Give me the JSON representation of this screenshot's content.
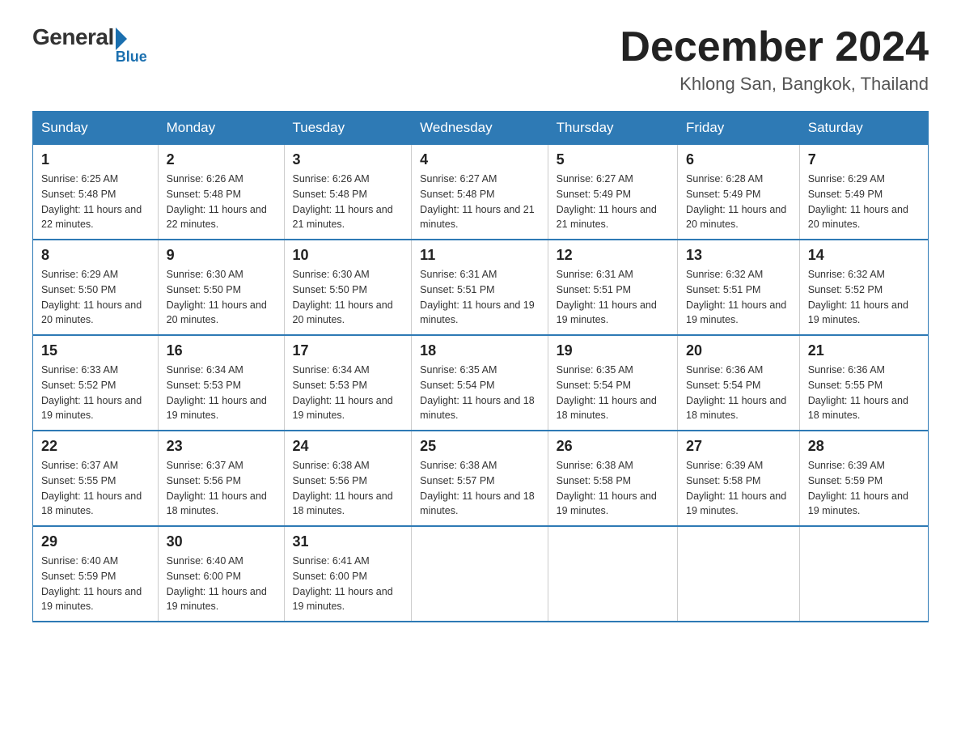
{
  "logo": {
    "general": "General",
    "blue": "Blue"
  },
  "title": "December 2024",
  "subtitle": "Khlong San, Bangkok, Thailand",
  "weekdays": [
    "Sunday",
    "Monday",
    "Tuesday",
    "Wednesday",
    "Thursday",
    "Friday",
    "Saturday"
  ],
  "weeks": [
    [
      {
        "day": "1",
        "sunrise": "6:25 AM",
        "sunset": "5:48 PM",
        "daylight": "11 hours and 22 minutes."
      },
      {
        "day": "2",
        "sunrise": "6:26 AM",
        "sunset": "5:48 PM",
        "daylight": "11 hours and 22 minutes."
      },
      {
        "day": "3",
        "sunrise": "6:26 AM",
        "sunset": "5:48 PM",
        "daylight": "11 hours and 21 minutes."
      },
      {
        "day": "4",
        "sunrise": "6:27 AM",
        "sunset": "5:48 PM",
        "daylight": "11 hours and 21 minutes."
      },
      {
        "day": "5",
        "sunrise": "6:27 AM",
        "sunset": "5:49 PM",
        "daylight": "11 hours and 21 minutes."
      },
      {
        "day": "6",
        "sunrise": "6:28 AM",
        "sunset": "5:49 PM",
        "daylight": "11 hours and 20 minutes."
      },
      {
        "day": "7",
        "sunrise": "6:29 AM",
        "sunset": "5:49 PM",
        "daylight": "11 hours and 20 minutes."
      }
    ],
    [
      {
        "day": "8",
        "sunrise": "6:29 AM",
        "sunset": "5:50 PM",
        "daylight": "11 hours and 20 minutes."
      },
      {
        "day": "9",
        "sunrise": "6:30 AM",
        "sunset": "5:50 PM",
        "daylight": "11 hours and 20 minutes."
      },
      {
        "day": "10",
        "sunrise": "6:30 AM",
        "sunset": "5:50 PM",
        "daylight": "11 hours and 20 minutes."
      },
      {
        "day": "11",
        "sunrise": "6:31 AM",
        "sunset": "5:51 PM",
        "daylight": "11 hours and 19 minutes."
      },
      {
        "day": "12",
        "sunrise": "6:31 AM",
        "sunset": "5:51 PM",
        "daylight": "11 hours and 19 minutes."
      },
      {
        "day": "13",
        "sunrise": "6:32 AM",
        "sunset": "5:51 PM",
        "daylight": "11 hours and 19 minutes."
      },
      {
        "day": "14",
        "sunrise": "6:32 AM",
        "sunset": "5:52 PM",
        "daylight": "11 hours and 19 minutes."
      }
    ],
    [
      {
        "day": "15",
        "sunrise": "6:33 AM",
        "sunset": "5:52 PM",
        "daylight": "11 hours and 19 minutes."
      },
      {
        "day": "16",
        "sunrise": "6:34 AM",
        "sunset": "5:53 PM",
        "daylight": "11 hours and 19 minutes."
      },
      {
        "day": "17",
        "sunrise": "6:34 AM",
        "sunset": "5:53 PM",
        "daylight": "11 hours and 19 minutes."
      },
      {
        "day": "18",
        "sunrise": "6:35 AM",
        "sunset": "5:54 PM",
        "daylight": "11 hours and 18 minutes."
      },
      {
        "day": "19",
        "sunrise": "6:35 AM",
        "sunset": "5:54 PM",
        "daylight": "11 hours and 18 minutes."
      },
      {
        "day": "20",
        "sunrise": "6:36 AM",
        "sunset": "5:54 PM",
        "daylight": "11 hours and 18 minutes."
      },
      {
        "day": "21",
        "sunrise": "6:36 AM",
        "sunset": "5:55 PM",
        "daylight": "11 hours and 18 minutes."
      }
    ],
    [
      {
        "day": "22",
        "sunrise": "6:37 AM",
        "sunset": "5:55 PM",
        "daylight": "11 hours and 18 minutes."
      },
      {
        "day": "23",
        "sunrise": "6:37 AM",
        "sunset": "5:56 PM",
        "daylight": "11 hours and 18 minutes."
      },
      {
        "day": "24",
        "sunrise": "6:38 AM",
        "sunset": "5:56 PM",
        "daylight": "11 hours and 18 minutes."
      },
      {
        "day": "25",
        "sunrise": "6:38 AM",
        "sunset": "5:57 PM",
        "daylight": "11 hours and 18 minutes."
      },
      {
        "day": "26",
        "sunrise": "6:38 AM",
        "sunset": "5:58 PM",
        "daylight": "11 hours and 19 minutes."
      },
      {
        "day": "27",
        "sunrise": "6:39 AM",
        "sunset": "5:58 PM",
        "daylight": "11 hours and 19 minutes."
      },
      {
        "day": "28",
        "sunrise": "6:39 AM",
        "sunset": "5:59 PM",
        "daylight": "11 hours and 19 minutes."
      }
    ],
    [
      {
        "day": "29",
        "sunrise": "6:40 AM",
        "sunset": "5:59 PM",
        "daylight": "11 hours and 19 minutes."
      },
      {
        "day": "30",
        "sunrise": "6:40 AM",
        "sunset": "6:00 PM",
        "daylight": "11 hours and 19 minutes."
      },
      {
        "day": "31",
        "sunrise": "6:41 AM",
        "sunset": "6:00 PM",
        "daylight": "11 hours and 19 minutes."
      },
      null,
      null,
      null,
      null
    ]
  ]
}
